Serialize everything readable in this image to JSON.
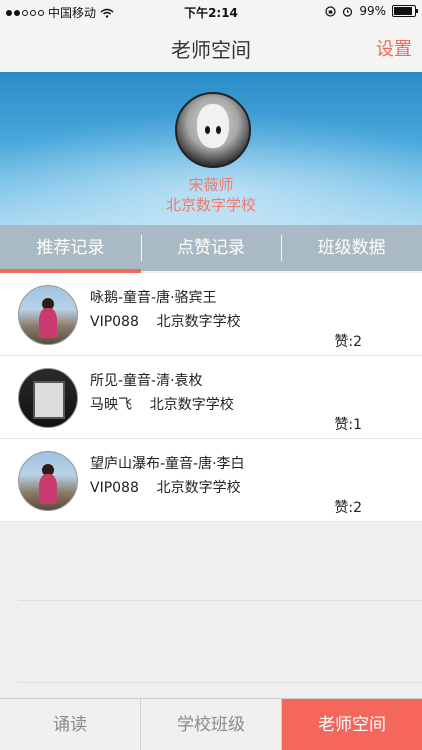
{
  "status_bar": {
    "carrier": "中国移动",
    "time": "下午2:14",
    "battery": "99%",
    "battery_level": 0.99,
    "icons": [
      "signal-dots-icon",
      "wifi-icon",
      "rotation-lock-icon",
      "alarm-icon",
      "battery-icon"
    ]
  },
  "header": {
    "title": "老师空间",
    "settings_label": "设置"
  },
  "profile": {
    "name": "宋薇师",
    "school": "北京数字学校"
  },
  "tabs": [
    {
      "label": "推荐记录",
      "active": true
    },
    {
      "label": "点赞记录",
      "active": false
    },
    {
      "label": "班级数据",
      "active": false
    }
  ],
  "records": [
    {
      "title": "咏鹅-童音-唐·骆宾王",
      "meta": "VIP088    北京数字学校",
      "likes": "赞:2"
    },
    {
      "title": "所见-童音-清·袁枚",
      "meta": "马映飞    北京数字学校",
      "likes": "赞:1"
    },
    {
      "title": "望庐山瀑布-童音-唐·李白",
      "meta": "VIP088    北京数字学校",
      "likes": "赞:2"
    }
  ],
  "bottom_tabs": [
    {
      "label": "诵读",
      "active": false
    },
    {
      "label": "学校班级",
      "active": false
    },
    {
      "label": "老师空间",
      "active": true
    }
  ],
  "colors": {
    "accent": "#f5675b",
    "profile_text": "#f07a6c"
  }
}
